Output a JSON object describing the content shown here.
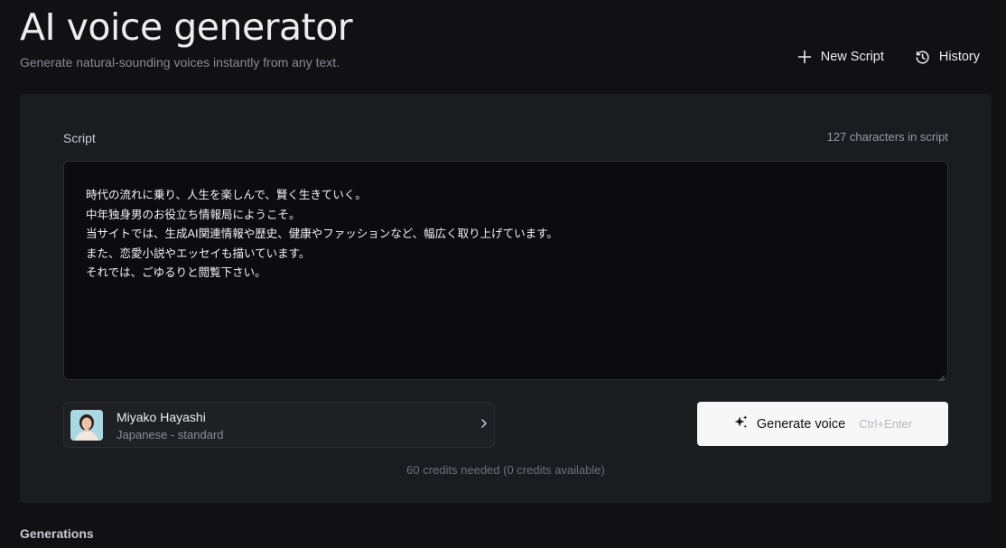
{
  "header": {
    "title": "AI voice generator",
    "subtitle": "Generate natural-sounding voices instantly from any text.",
    "actions": {
      "new_script": "New Script",
      "history": "History"
    }
  },
  "script": {
    "label": "Script",
    "char_count": "127 characters in script",
    "lines": [
      "時代の流れに乗り、人生を楽しんで、賢く生きていく。",
      "中年独身男のお役立ち情報局にようこそ。",
      "当サイトでは、生成AI関連情報や歴史、健康やファッションなど、幅広く取り上げています。",
      "また、恋愛小説やエッセイも描いています。",
      "それでは、ごゆるりと閲覧下さい。"
    ]
  },
  "voice": {
    "name": "Miyako Hayashi",
    "description": "Japanese - standard"
  },
  "generate": {
    "label": "Generate voice",
    "shortcut": "Ctrl+Enter"
  },
  "credits_text": "60 credits needed (0 credits available)",
  "generations": {
    "title": "Generations"
  },
  "colors": {
    "background": "#111114",
    "panel": "#1b1c20",
    "textarea": "#0c0c0e",
    "primary_button": "#f7f7f8"
  },
  "icons": {
    "new_script": "plus-icon",
    "history": "history-clock-icon",
    "generate": "sparkle-icon",
    "voice_select": "chevron-right-icon"
  }
}
